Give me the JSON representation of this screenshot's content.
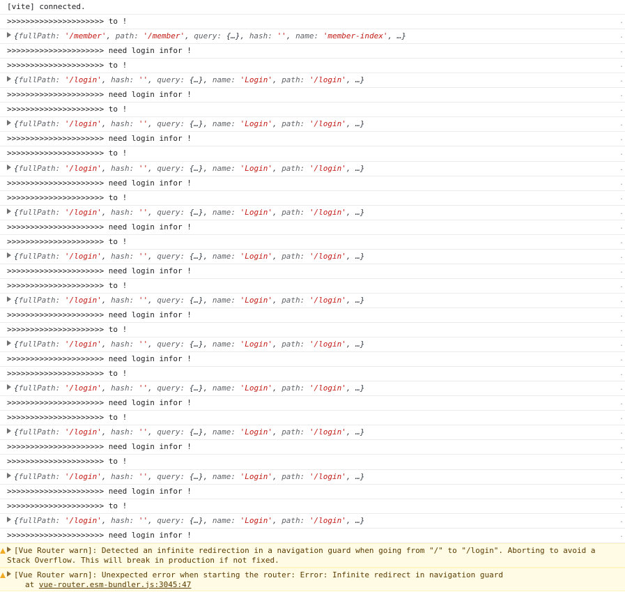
{
  "console": {
    "rows": [
      {
        "type": "text",
        "text": "[vite] connected."
      },
      {
        "type": "text",
        "text": ">>>>>>>>>>>>>>>>>>>>> to !"
      },
      {
        "type": "object",
        "parts": [
          [
            "p",
            "{"
          ],
          [
            "k",
            "fullPath: "
          ],
          [
            "s",
            "'/member'"
          ],
          [
            "p",
            ", "
          ],
          [
            "k",
            "path: "
          ],
          [
            "s",
            "'/member'"
          ],
          [
            "p",
            ", "
          ],
          [
            "k",
            "query: "
          ],
          [
            "p",
            "{…}, "
          ],
          [
            "k",
            "hash: "
          ],
          [
            "s",
            "''"
          ],
          [
            "p",
            ", "
          ],
          [
            "k",
            "name: "
          ],
          [
            "s",
            "'member-index'"
          ],
          [
            "p",
            ", …}"
          ]
        ]
      },
      {
        "type": "text",
        "text": ">>>>>>>>>>>>>>>>>>>>> need login infor !"
      },
      {
        "type": "text",
        "text": ">>>>>>>>>>>>>>>>>>>>> to !"
      },
      {
        "type": "object",
        "ref": "login"
      },
      {
        "type": "text",
        "text": ">>>>>>>>>>>>>>>>>>>>> need login infor !"
      },
      {
        "type": "text",
        "text": ">>>>>>>>>>>>>>>>>>>>> to !"
      },
      {
        "type": "object",
        "ref": "login"
      },
      {
        "type": "text",
        "text": ">>>>>>>>>>>>>>>>>>>>> need login infor !"
      },
      {
        "type": "text",
        "text": ">>>>>>>>>>>>>>>>>>>>> to !"
      },
      {
        "type": "object",
        "ref": "login"
      },
      {
        "type": "text",
        "text": ">>>>>>>>>>>>>>>>>>>>> need login infor !"
      },
      {
        "type": "text",
        "text": ">>>>>>>>>>>>>>>>>>>>> to !"
      },
      {
        "type": "object",
        "ref": "login"
      },
      {
        "type": "text",
        "text": ">>>>>>>>>>>>>>>>>>>>> need login infor !"
      },
      {
        "type": "text",
        "text": ">>>>>>>>>>>>>>>>>>>>> to !"
      },
      {
        "type": "object",
        "ref": "login"
      },
      {
        "type": "text",
        "text": ">>>>>>>>>>>>>>>>>>>>> need login infor !"
      },
      {
        "type": "text",
        "text": ">>>>>>>>>>>>>>>>>>>>> to !"
      },
      {
        "type": "object",
        "ref": "login"
      },
      {
        "type": "text",
        "text": ">>>>>>>>>>>>>>>>>>>>> need login infor !"
      },
      {
        "type": "text",
        "text": ">>>>>>>>>>>>>>>>>>>>> to !"
      },
      {
        "type": "object",
        "ref": "login"
      },
      {
        "type": "text",
        "text": ">>>>>>>>>>>>>>>>>>>>> need login infor !"
      },
      {
        "type": "text",
        "text": ">>>>>>>>>>>>>>>>>>>>> to !"
      },
      {
        "type": "object",
        "ref": "login"
      },
      {
        "type": "text",
        "text": ">>>>>>>>>>>>>>>>>>>>> need login infor !"
      },
      {
        "type": "text",
        "text": ">>>>>>>>>>>>>>>>>>>>> to !"
      },
      {
        "type": "object",
        "ref": "login"
      },
      {
        "type": "text",
        "text": ">>>>>>>>>>>>>>>>>>>>> need login infor !"
      },
      {
        "type": "text",
        "text": ">>>>>>>>>>>>>>>>>>>>> to !"
      },
      {
        "type": "object",
        "ref": "login"
      },
      {
        "type": "text",
        "text": ">>>>>>>>>>>>>>>>>>>>> need login infor !"
      },
      {
        "type": "text",
        "text": ">>>>>>>>>>>>>>>>>>>>> to !"
      },
      {
        "type": "object",
        "ref": "login"
      },
      {
        "type": "text",
        "text": ">>>>>>>>>>>>>>>>>>>>> need login infor !"
      }
    ],
    "login_object_parts": [
      [
        "p",
        "{"
      ],
      [
        "k",
        "fullPath: "
      ],
      [
        "s",
        "'/login'"
      ],
      [
        "p",
        ", "
      ],
      [
        "k",
        "hash: "
      ],
      [
        "s",
        "''"
      ],
      [
        "p",
        ", "
      ],
      [
        "k",
        "query: "
      ],
      [
        "p",
        "{…}, "
      ],
      [
        "k",
        "name: "
      ],
      [
        "s",
        "'Login'"
      ],
      [
        "p",
        ", "
      ],
      [
        "k",
        "path: "
      ],
      [
        "s",
        "'/login'"
      ],
      [
        "p",
        ", …}"
      ]
    ],
    "source_marker": ".",
    "warnings": [
      {
        "text": "[Vue Router warn]: Detected an infinite redirection in a navigation guard when going from \"/\" to \"/login\". Aborting to avoid a Stack Overflow. This will break in production if not fixed."
      },
      {
        "text": "[Vue Router warn]: Unexpected error when starting the router: Error: Infinite redirect in navigation guard",
        "stack_prefix": "at ",
        "stack_link": "vue-router.esm-bundler.js:3045:47"
      }
    ]
  }
}
